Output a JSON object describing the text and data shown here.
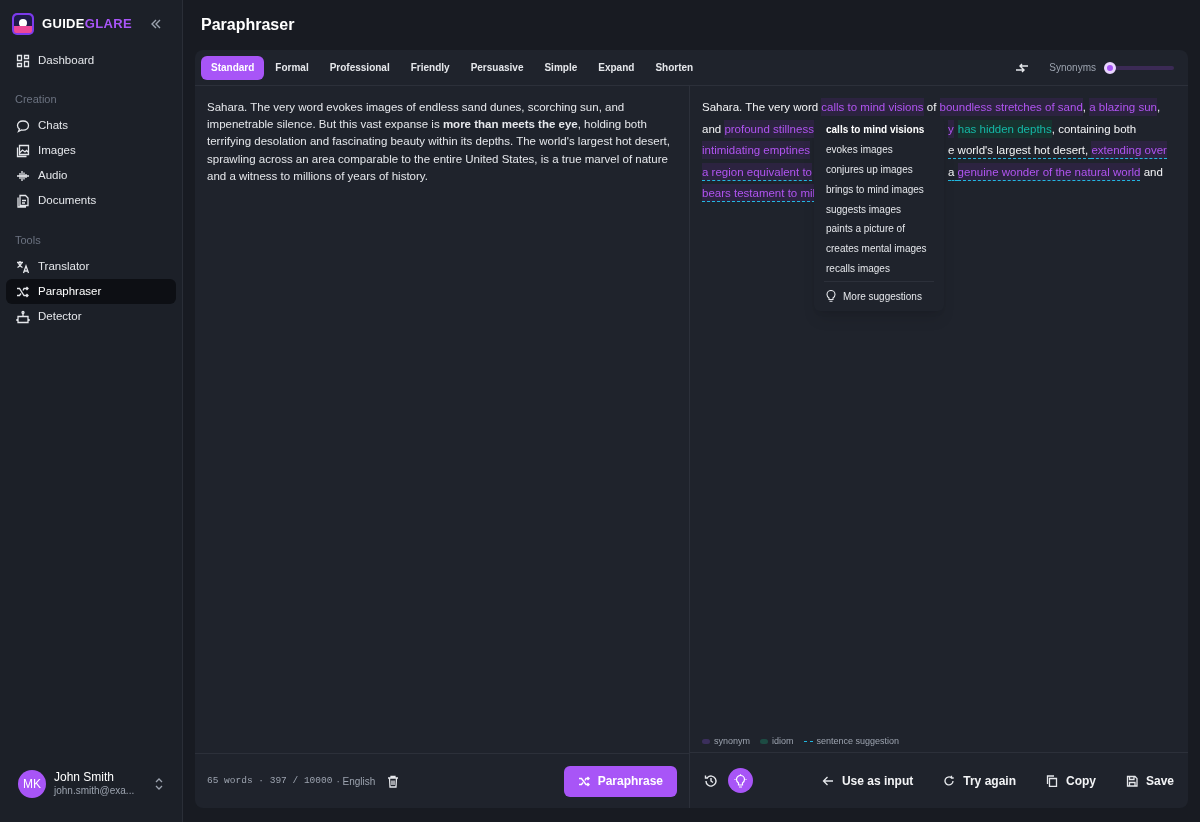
{
  "brand": {
    "first": "GUIDE",
    "second": "GLARE"
  },
  "sidebar": {
    "sections": [
      {
        "items": [
          {
            "label": "Dashboard",
            "selected": false
          }
        ]
      },
      {
        "heading": "Creation",
        "items": [
          {
            "label": "Chats",
            "selected": false
          },
          {
            "label": "Images",
            "selected": false
          },
          {
            "label": "Audio",
            "selected": false
          },
          {
            "label": "Documents",
            "selected": false
          }
        ]
      },
      {
        "heading": "Tools",
        "items": [
          {
            "label": "Translator",
            "selected": false
          },
          {
            "label": "Paraphraser",
            "selected": true
          },
          {
            "label": "Detector",
            "selected": false
          }
        ]
      }
    ]
  },
  "user": {
    "initials": "MK",
    "name": "John Smith",
    "email": "john.smith@exa..."
  },
  "page_title": "Paraphraser",
  "tabs": [
    {
      "label": "Standard",
      "selected": true
    },
    {
      "label": "Formal",
      "selected": false
    },
    {
      "label": "Professional",
      "selected": false
    },
    {
      "label": "Friendly",
      "selected": false
    },
    {
      "label": "Persuasive",
      "selected": false
    },
    {
      "label": "Simple",
      "selected": false
    },
    {
      "label": "Expand",
      "selected": false
    },
    {
      "label": "Shorten",
      "selected": false
    }
  ],
  "synonyms": {
    "label": "Synonyms",
    "level": 0.0
  },
  "input_text": "Sahara. The very word evokes images of endless sand dunes, scorching sun, and impenetrable silence. But this vast expanse is **more than meets the eye**, holding both terrifying desolation and fascinating beauty within its depths. The world's largest hot desert, sprawling across an area comparable to the entire United States, is a true marvel of nature and a witness to millions of years of history.",
  "output_lines": [
    {
      "left": [
        {
          "text": "Sahara. The very word ",
          "kind": "plain",
          "underlined": false
        },
        {
          "text": "calls to mind visions",
          "kind": "synonym",
          "underlined": false
        },
        {
          "text": " of ",
          "kind": "plain",
          "underlined": false
        },
        {
          "text": "boundless stretches of sand",
          "kind": "synonym",
          "underlined": false
        },
        {
          "text": ", ",
          "kind": "plain",
          "underlined": false
        },
        {
          "text": "a blazing sun",
          "kind": "synonym",
          "underlined": false
        },
        {
          "text": ",",
          "kind": "plain",
          "underlined": false
        }
      ]
    },
    {
      "left": [
        {
          "text": "and ",
          "kind": "plain",
          "underlined": false
        },
        {
          "text": "profound stillness",
          "kind": "synonym",
          "underlined": false
        }
      ],
      "right": [
        {
          "text": "y",
          "kind": "synonym",
          "underlined": false
        },
        {
          "text": "has hidden depths",
          "kind": "idiom",
          "underlined": false
        },
        {
          "text": ", containing both",
          "kind": "plain",
          "underlined": false
        }
      ]
    },
    {
      "left": [
        {
          "text": "intimidating emptines",
          "kind": "synonym",
          "underlined": false
        }
      ],
      "right": [
        {
          "text": "e world's largest hot desert, ",
          "kind": "plain",
          "underlined": true
        },
        {
          "text": "extending over",
          "kind": "synonym",
          "underlined": true
        }
      ]
    },
    {
      "left": [
        {
          "text": "a region equivalent to",
          "kind": "synonym",
          "underlined": true
        }
      ],
      "right": [
        {
          "text": "a ",
          "kind": "plain",
          "underlined": true
        },
        {
          "text": "genuine wonder of the natural world",
          "kind": "synonym",
          "underlined": true
        },
        {
          "text": " and",
          "kind": "plain",
          "underlined": false
        }
      ]
    },
    {
      "left": [
        {
          "text": "bears testament to mil",
          "kind": "synonym",
          "underlined": true
        }
      ]
    }
  ],
  "suggestions": {
    "items": [
      {
        "label": "calls to mind visions",
        "selected": true
      },
      {
        "label": "evokes images",
        "selected": false
      },
      {
        "label": "conjures up images",
        "selected": false
      },
      {
        "label": "brings to mind images",
        "selected": false
      },
      {
        "label": "suggests images",
        "selected": false
      },
      {
        "label": "paints a picture of",
        "selected": false
      },
      {
        "label": "creates mental images",
        "selected": false
      },
      {
        "label": "recalls images",
        "selected": false
      }
    ],
    "more": "More suggestions"
  },
  "legend": [
    {
      "label": "synonym",
      "kind": "synonym"
    },
    {
      "label": "idiom",
      "kind": "idiom"
    },
    {
      "label": "sentence suggestion",
      "kind": "sentence"
    }
  ],
  "input_footer": {
    "counts": "65 words · 397 / 10000",
    "language": "· English",
    "button": "Paraphrase"
  },
  "output_footer": {
    "suggestions_on": true,
    "actions": [
      {
        "label": "Use as input"
      },
      {
        "label": "Try again"
      },
      {
        "label": "Copy"
      },
      {
        "label": "Save"
      }
    ]
  }
}
